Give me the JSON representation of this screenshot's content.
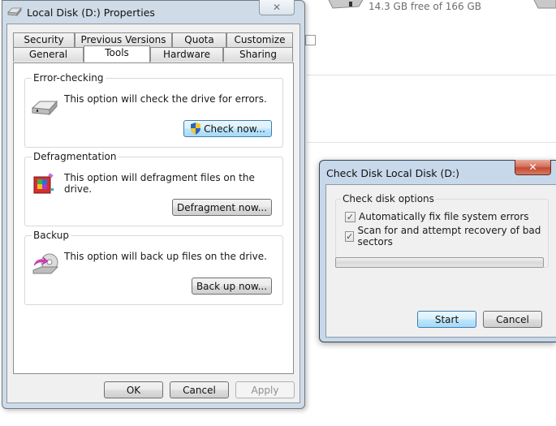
{
  "background": {
    "drive_free_text": "14.3 GB free of 166 GB"
  },
  "properties_window": {
    "title": "Local Disk (D:) Properties",
    "close_label": "✕",
    "tabs_row1": [
      "Security",
      "Previous Versions",
      "Quota",
      "Customize"
    ],
    "tabs_row2": [
      "General",
      "Tools",
      "Hardware",
      "Sharing"
    ],
    "active_tab": "Tools",
    "groups": {
      "error_checking": {
        "label": "Error-checking",
        "description": "This option will check the drive for errors.",
        "button": "Check now..."
      },
      "defragmentation": {
        "label": "Defragmentation",
        "description": "This option will defragment files on the drive.",
        "button": "Defragment now..."
      },
      "backup": {
        "label": "Backup",
        "description": "This option will back up files on the drive.",
        "button": "Back up now..."
      }
    },
    "footer": {
      "ok": "OK",
      "cancel": "Cancel",
      "apply": "Apply"
    }
  },
  "check_disk_dialog": {
    "title": "Check Disk Local Disk (D:)",
    "close_label": "✕",
    "group_label": "Check disk options",
    "options": [
      {
        "label": "Automatically fix file system errors",
        "checked": true
      },
      {
        "label": "Scan for and attempt recovery of bad sectors",
        "checked": true
      }
    ],
    "progress_percent": 0,
    "start": "Start",
    "cancel": "Cancel"
  }
}
